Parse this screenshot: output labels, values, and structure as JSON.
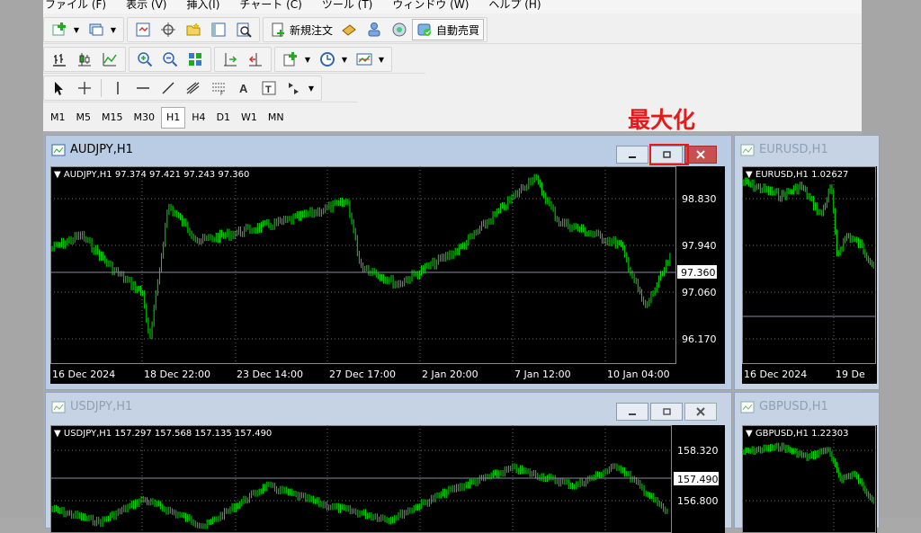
{
  "menu": [
    "ファイル (F)",
    "表示 (V)",
    "挿入(I)",
    "チャート (C)",
    "ツール (T)",
    "ウィンドウ (W)",
    "ヘルプ (H)"
  ],
  "toolbar1": {
    "new_order_label": "新規注文",
    "auto_trade_label": "自動売買"
  },
  "timeframes": [
    "M1",
    "M5",
    "M15",
    "M30",
    "H1",
    "H4",
    "D1",
    "W1",
    "MN"
  ],
  "active_timeframe": "H1",
  "annotation": "最大化",
  "annotation_color": "#e41b1b",
  "windows": {
    "audjpy": {
      "title": "AUDJPY,H1",
      "header": "AUDJPY,H1  97.374 97.421 97.243 97.360",
      "price_ticks": [
        "98.830",
        "97.940",
        "97.060",
        "96.170"
      ],
      "current_price": "97.360",
      "time_ticks": [
        "16 Dec 2024",
        "18 Dec 22:00",
        "23 Dec 14:00",
        "27 Dec 17:00",
        "2 Jan 20:00",
        "7 Jan 12:00",
        "10 Jan 04:00"
      ]
    },
    "eurusd": {
      "title": "EURUSD,H1",
      "header": "EURUSD,H1  1.02627",
      "time_ticks": [
        "16 Dec 2024",
        "19 De"
      ]
    },
    "usdjpy": {
      "title": "USDJPY,H1",
      "header": "USDJPY,H1  157.297 157.568 157.135 157.490",
      "price_ticks": [
        "158.320",
        "156.800"
      ],
      "current_price": "157.490"
    },
    "gbpusd": {
      "title": "GBPUSD,H1",
      "header": "GBPUSD,H1  1.22303"
    }
  },
  "colors": {
    "candle": "#00e000",
    "chart_bg": "#000000",
    "grid": "#6a6a6a"
  }
}
